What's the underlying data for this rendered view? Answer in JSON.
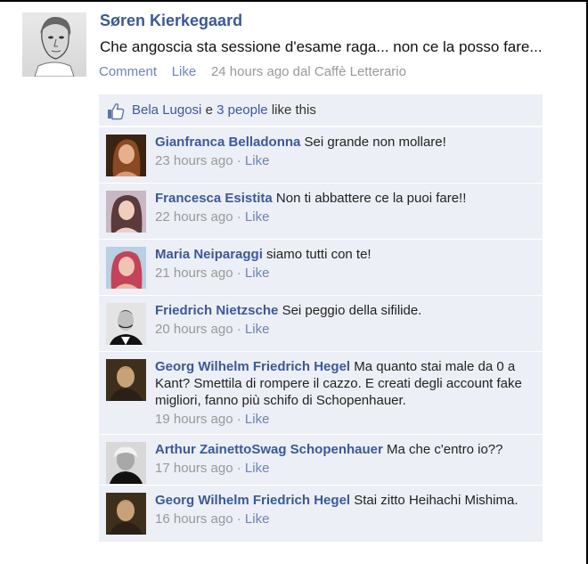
{
  "post": {
    "author": "Søren Kierkegaard",
    "text": "Che angoscia sta sessione d'esame raga... non ce la posso fare...",
    "comment_label": "Comment",
    "like_label": "Like",
    "time": "24 hours ago dal Caffè Letterario"
  },
  "likes": {
    "names": "Bela Lugosi",
    "connector": " e ",
    "people": "3 people",
    "suffix": " like this"
  },
  "comments": [
    {
      "name": "Gianfranca Belladonna",
      "text": "Sei grande non mollare!",
      "time": "23 hours ago",
      "like": "Like"
    },
    {
      "name": "Francesca Esistita",
      "text": "Non ti abbattere ce la puoi fare!!",
      "time": "22 hours ago",
      "like": "Like"
    },
    {
      "name": "Maria Neiparaggi",
      "text": "siamo tutti con te!",
      "time": "21 hours ago",
      "like": "Like"
    },
    {
      "name": "Friedrich Nietzsche",
      "text": "Sei peggio della sifilide.",
      "time": "20 hours ago",
      "like": "Like"
    },
    {
      "name": "Georg Wilhelm Friedrich Hegel",
      "text": "Ma quanto stai male da 0 a Kant? Smettila di rompere il cazzo. E creati degli account fake migliori, fanno più schifo di Schopenhauer.",
      "time": "19 hours ago",
      "like": "Like"
    },
    {
      "name": "Arthur ZainettoSwag Schopenhauer",
      "text": "Ma che c'entro io??",
      "time": "17 hours ago",
      "like": "Like"
    },
    {
      "name": "Georg Wilhelm Friedrich Hegel",
      "text": "Stai zitto Heihachi Mishima.",
      "time": "16 hours ago",
      "like": "Like"
    }
  ]
}
